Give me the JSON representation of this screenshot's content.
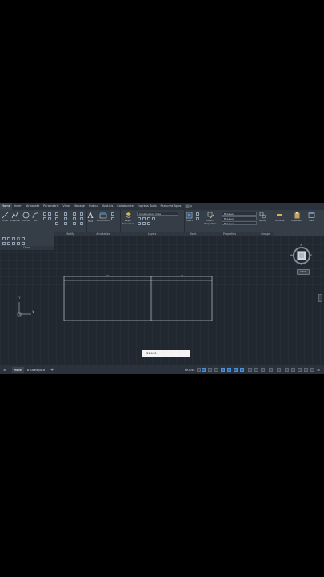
{
  "tabs": [
    "Home",
    "Insert",
    "Annotate",
    "Parametric",
    "View",
    "Manage",
    "Output",
    "Add-ins",
    "Collaborate",
    "Express Tools",
    "Featured Apps"
  ],
  "draw_tools": [
    "Line",
    "Polyline",
    "Circle",
    "Arc"
  ],
  "panels": {
    "draw": "Draw",
    "modify": "Modify",
    "annotation": "Annotation",
    "layers": "Layers",
    "block": "Block",
    "properties": "Properties",
    "groups": "Groups"
  },
  "annotation_tools": [
    "Text",
    "Dimension"
  ],
  "layers": {
    "props_label": "Layer Properties",
    "current_layer": "Construction lines"
  },
  "block": {
    "insert": "Insert",
    "match": "Match Properties"
  },
  "properties": {
    "color": "ByLayer",
    "linetype": "ByLayer",
    "lineweight": "ByLayer"
  },
  "groups": {
    "group": "Group"
  },
  "right_tools": [
    "Utilities",
    "Clipboard",
    "View"
  ],
  "viewcube": {
    "north": "N",
    "south": "S",
    "west": "W",
    "east": "E",
    "wcs": "WCS"
  },
  "ucs": {
    "x": "X",
    "y": "Y"
  },
  "tooltip": {
    "value": "31.190"
  },
  "status": {
    "menu_icon": "≡",
    "model_tab": "Model",
    "layout_tab": "8 Sizeⅼayout",
    "add": "+",
    "mode": "MODEL"
  },
  "colors": {
    "background": "#212830",
    "ribbon": "#353d47",
    "accent": "#4a90d9"
  }
}
